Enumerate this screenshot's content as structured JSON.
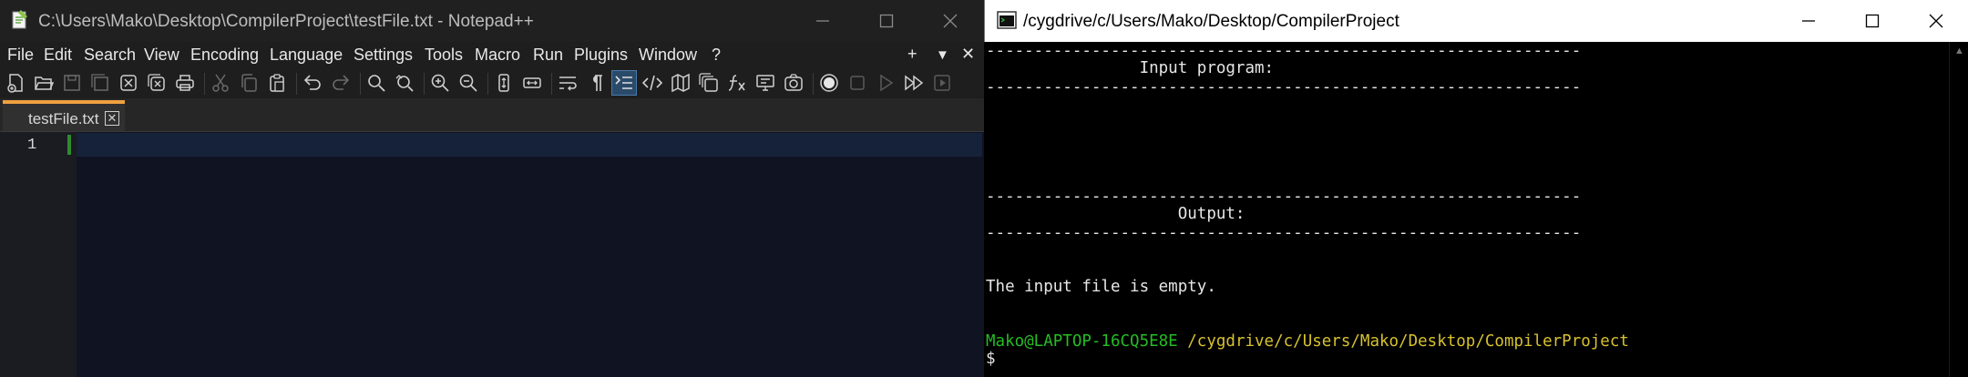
{
  "notepad": {
    "title": "C:\\Users\\Mako\\Desktop\\CompilerProject\\testFile.txt - Notepad++",
    "menu": [
      "File",
      "Edit",
      "Search",
      "View",
      "Encoding",
      "Language",
      "Settings",
      "Tools",
      "Macro",
      "Run",
      "Plugins",
      "Window",
      "?"
    ],
    "menu_right": {
      "plus": "+",
      "dropdown": "▼",
      "close": "✕"
    },
    "tab": {
      "label": "testFile.txt",
      "close": "✕"
    },
    "line_number": "1",
    "colors": {
      "accent_tab": "#f0a040",
      "line_marker": "#2e8b2e",
      "editor_bg": "#0f1322"
    }
  },
  "terminal": {
    "title": "/cygdrive/c/Users/Mako/Desktop/CompilerProject",
    "lines": {
      "sep1": "--------------------------------------------------------------",
      "input_header": "                Input program:",
      "sep2": "--------------------------------------------------------------",
      "sep3": "--------------------------------------------------------------",
      "output_header": "                    Output:",
      "sep4": "--------------------------------------------------------------",
      "message": "The input file is empty.",
      "prompt_user": "Mako@LAPTOP-16CQ5E8E",
      "prompt_path": "/cygdrive/c/Users/Mako/Desktop/CompilerProject",
      "prompt_symbol": "$"
    },
    "colors": {
      "user": "#25bc24",
      "path": "#d6c12f",
      "text": "#e6e6e6"
    }
  }
}
